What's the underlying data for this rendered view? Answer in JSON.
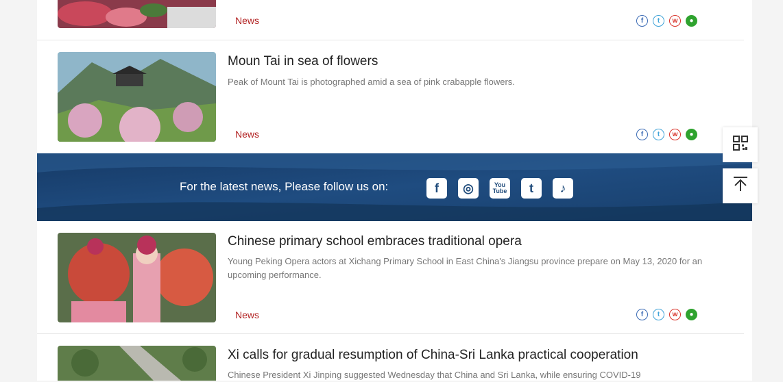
{
  "articles": [
    {
      "title": "",
      "desc": "",
      "category": "News"
    },
    {
      "title": "Moun Tai in sea of flowers",
      "desc": "Peak of Mount Tai is photographed amid a sea of pink crabapple flowers.",
      "category": "News"
    },
    {
      "title": "Chinese primary school embraces traditional opera",
      "desc": "Young Peking Opera actors at Xichang Primary School in East China's Jiangsu province prepare on May 13, 2020 for an upcoming performance.",
      "category": "News"
    },
    {
      "title": "Xi calls for gradual resumption of China-Sri Lanka practical cooperation",
      "desc": "Chinese President Xi Jinping suggested Wednesday that China and Sri Lanka, while ensuring COVID-19",
      "category": ""
    }
  ],
  "banner": {
    "text": "For the latest news, Please follow us on:",
    "icons": [
      "facebook-icon",
      "instagram-icon",
      "youtube-icon",
      "twitter-icon",
      "tiktok-icon"
    ]
  },
  "share_icons": [
    "facebook-share-icon",
    "twitter-share-icon",
    "weibo-share-icon",
    "wechat-share-icon"
  ],
  "colors": {
    "category": "#b22222",
    "banner": "#1e4a7a",
    "facebook": "#3b6bb5",
    "twitter": "#3fa3d8",
    "weibo": "#d9342b",
    "wechat": "#2fa32f"
  }
}
